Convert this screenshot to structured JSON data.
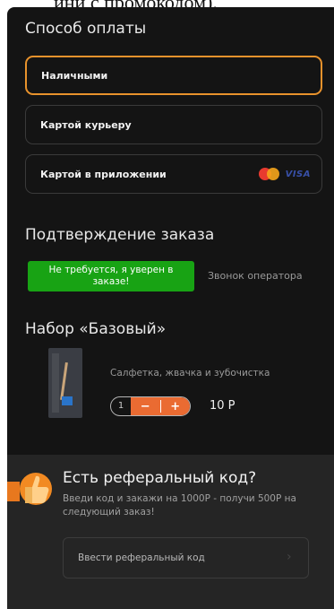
{
  "top_text": "ини с промокодом).",
  "payment": {
    "title": "Способ оплаты",
    "options": [
      {
        "label": "Наличными",
        "selected": true
      },
      {
        "label": "Картой курьеру",
        "selected": false
      },
      {
        "label": "Картой в приложении",
        "selected": false
      }
    ],
    "visa_label": "VISA"
  },
  "confirmation": {
    "title": "Подтверждение заказа",
    "options": [
      {
        "label": "Не требуется, я уверен в заказе!",
        "selected": true
      },
      {
        "label": "Звонок оператора",
        "selected": false
      }
    ]
  },
  "kit": {
    "title": "Набор «Базовый»",
    "description": "Салфетка, жвачка и зубочистка",
    "quantity": "1",
    "minus": "−",
    "plus": "+",
    "price": "10 Р"
  },
  "referral": {
    "title": "Есть реферальный код?",
    "text": "Введи код и закажи на 1000Р - получи 500Р на следующий заказ!",
    "placeholder": "Ввести реферальный код",
    "arrow": "›"
  },
  "colors": {
    "accent": "#e8922c",
    "confirm_green": "#18a314",
    "stepper_orange": "#ea6b32",
    "background": "#141414"
  }
}
